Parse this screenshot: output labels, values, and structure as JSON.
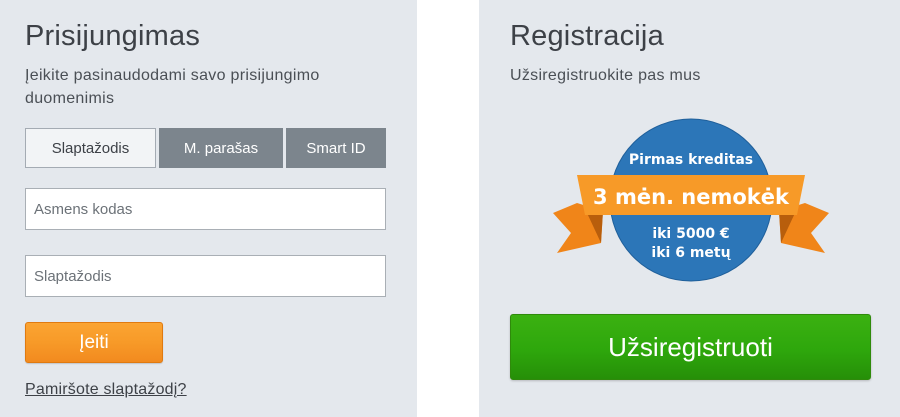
{
  "login": {
    "title": "Prisijungimas",
    "subtitle_line1": "Įeikite pasinaudodami savo prisijungimo",
    "subtitle_line2": "duomenimis",
    "tabs": [
      {
        "label": "Slaptažodis",
        "active": true
      },
      {
        "label": "M. parašas",
        "active": false
      },
      {
        "label": "Smart ID",
        "active": false
      }
    ],
    "personal_code_placeholder": "Asmens kodas",
    "password_placeholder": "Slaptažodis",
    "submit_label": "Įeiti",
    "forgot_label": "Pamiršote slaptažodį?"
  },
  "registration": {
    "title": "Registracija",
    "subtitle": "Užsiregistruokite pas mus",
    "promo": {
      "line1": "Pirmas kreditas",
      "ribbon": "3 mėn. nemokėk",
      "line2": "iki 5000 €",
      "line3": "iki 6 metų"
    },
    "register_label": "Užsiregistruoti"
  },
  "colors": {
    "panel_bg": "#e4e8ed",
    "accent_orange": "#f79a28",
    "accent_green": "#2ea70c",
    "badge_blue": "#2872b5",
    "tab_inactive": "#7c858d"
  }
}
